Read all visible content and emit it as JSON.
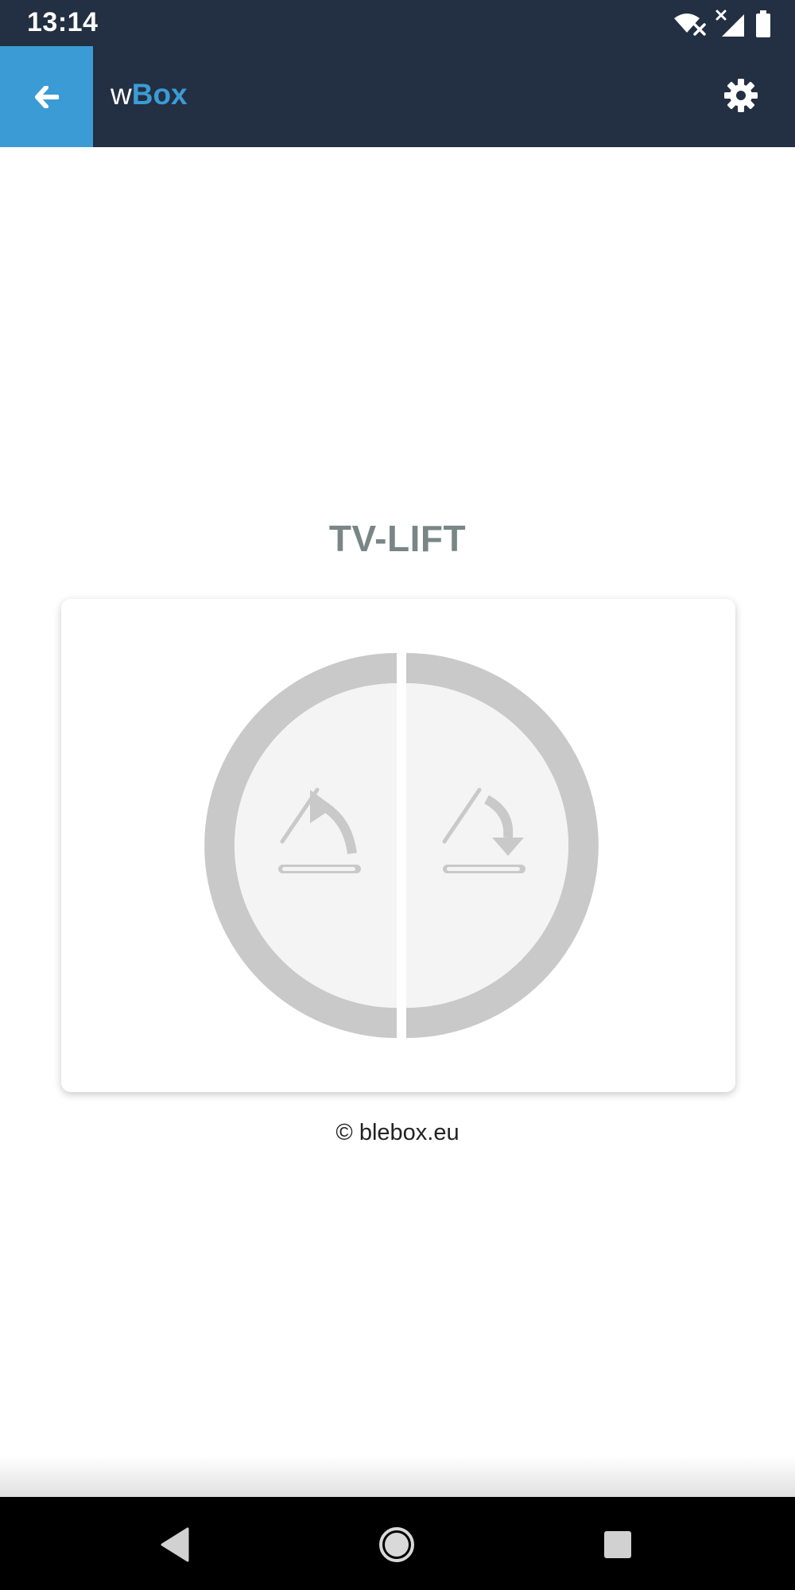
{
  "status_bar": {
    "time": "13:14",
    "icons": [
      "wifi-off-icon",
      "signal-no-data-icon",
      "battery-icon"
    ]
  },
  "app_bar": {
    "back_icon": "arrow-left-icon",
    "title_prefix": "w",
    "title_suffix": "Box",
    "settings_icon": "gear-icon",
    "accent_color": "#3b9cd5",
    "background_color": "#232f42"
  },
  "device": {
    "name": "TV-LIFT",
    "controls": [
      {
        "id": "lift-up",
        "icon": "tv-lift-up-icon"
      },
      {
        "id": "lift-down",
        "icon": "tv-lift-down-icon"
      }
    ],
    "ring_color": "#c9c9c9",
    "face_color": "#f4f4f4"
  },
  "footer": {
    "copyright": "© blebox.eu"
  },
  "nav_bar": {
    "icons": [
      "back-triangle-icon",
      "home-circle-icon",
      "recents-square-icon"
    ]
  }
}
